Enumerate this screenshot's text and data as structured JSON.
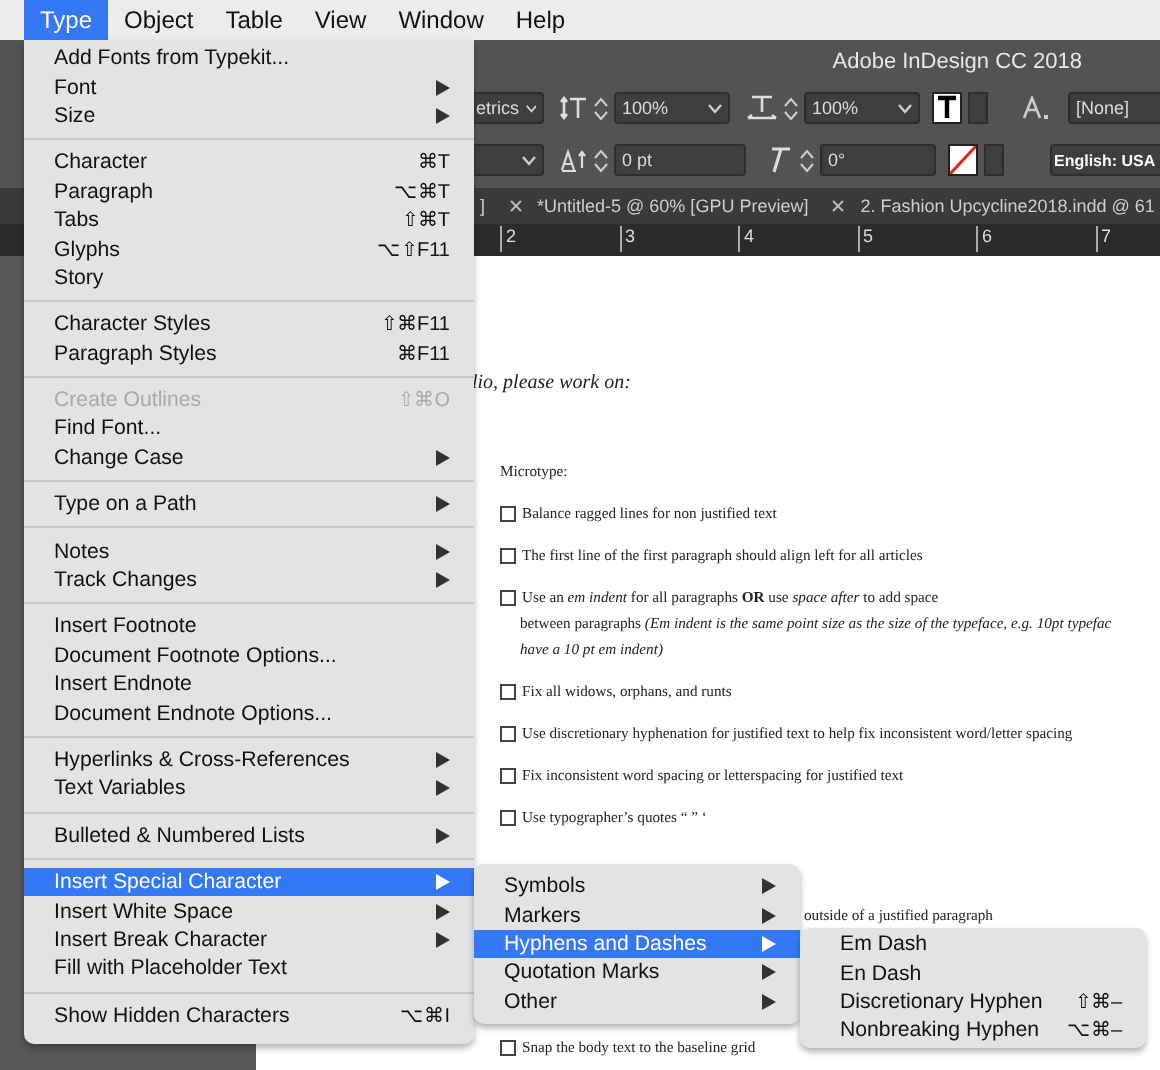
{
  "menu_bar": {
    "items": [
      {
        "label": "Type",
        "selected": true
      },
      {
        "label": "Object",
        "selected": false
      },
      {
        "label": "Table",
        "selected": false
      },
      {
        "label": "View",
        "selected": false
      },
      {
        "label": "Window",
        "selected": false
      },
      {
        "label": "Help",
        "selected": false
      }
    ]
  },
  "window": {
    "title": "Adobe InDesign CC 2018"
  },
  "control_panel": {
    "kerning": "etrics",
    "vertical_scale": "100%",
    "horizontal_scale": "100%",
    "baseline_shift": "0 pt",
    "skew": "0°",
    "character_style": "[None]",
    "language": "English: USA"
  },
  "document_tabs": [
    {
      "label": "]",
      "close_visible": false
    },
    {
      "label": "*Untitled-5 @ 60% [GPU Preview]",
      "close_visible": true
    },
    {
      "label": "2. Fashion Upcycline2018.indd @ 61",
      "close_visible": true
    }
  ],
  "ruler": {
    "marks": [
      "2",
      "3",
      "4",
      "5",
      "6",
      "7"
    ]
  },
  "page": {
    "heading": "lio, please work on:",
    "items": [
      {
        "kind": "label",
        "lines": [
          "Microtype:"
        ]
      },
      {
        "kind": "checkbox",
        "checked": false,
        "lines": [
          "Balance ragged lines for non justified text"
        ]
      },
      {
        "kind": "checkbox",
        "checked": false,
        "lines": [
          "The first line of the first paragraph should align left for all articles"
        ]
      },
      {
        "kind": "checkbox",
        "checked": false,
        "lines": [
          "Use an *em indent* for all paragraphs **OR** use *space after* to add space",
          "between paragraphs *(Em indent is the same point size as the size of the typeface, e.g. 10pt typefac*",
          "*have a 10 pt em indent)*"
        ]
      },
      {
        "kind": "checkbox",
        "checked": false,
        "lines": [
          "Fix all widows, orphans, and runts"
        ]
      },
      {
        "kind": "checkbox",
        "checked": false,
        "lines": [
          "Use discretionary hyphenation for justified text to help fix inconsistent word/letter spacing"
        ]
      },
      {
        "kind": "checkbox",
        "checked": false,
        "lines": [
          "Fix inconsistent word spacing or letterspacing for justified text"
        ]
      },
      {
        "kind": "checkbox",
        "checked": false,
        "lines": [
          "Use typographer’s quotes “ ” ‘"
        ]
      },
      {
        "kind": "fragment",
        "lines": [
          "outside of a justified paragraph"
        ]
      },
      {
        "kind": "checkbox",
        "checked": false,
        "lines": [
          "Snap the body text to the baseline grid"
        ]
      }
    ]
  },
  "type_menu": {
    "groups": [
      [
        {
          "label": "Add Fonts from Typekit...",
          "submenu": false,
          "disabled": false,
          "selected": false
        },
        {
          "label": "Font",
          "submenu": true,
          "disabled": false,
          "selected": false
        },
        {
          "label": "Size",
          "submenu": true,
          "disabled": false,
          "selected": false
        }
      ],
      [
        {
          "label": "Character",
          "shortcut": "⌘T",
          "submenu": false,
          "disabled": false,
          "selected": false
        },
        {
          "label": "Paragraph",
          "shortcut": "⌥⌘T",
          "submenu": false,
          "disabled": false,
          "selected": false
        },
        {
          "label": "Tabs",
          "shortcut": "⇧⌘T",
          "submenu": false,
          "disabled": false,
          "selected": false
        },
        {
          "label": "Glyphs",
          "shortcut": "⌥⇧F11",
          "submenu": false,
          "disabled": false,
          "selected": false
        },
        {
          "label": "Story",
          "submenu": false,
          "disabled": false,
          "selected": false
        }
      ],
      [
        {
          "label": "Character Styles",
          "shortcut": "⇧⌘F11",
          "submenu": false,
          "disabled": false,
          "selected": false
        },
        {
          "label": "Paragraph Styles",
          "shortcut": "⌘F11",
          "submenu": false,
          "disabled": false,
          "selected": false
        }
      ],
      [
        {
          "label": "Create Outlines",
          "shortcut": "⇧⌘O",
          "submenu": false,
          "disabled": true,
          "selected": false
        },
        {
          "label": "Find Font...",
          "submenu": false,
          "disabled": false,
          "selected": false
        },
        {
          "label": "Change Case",
          "submenu": true,
          "disabled": false,
          "selected": false
        }
      ],
      [
        {
          "label": "Type on a Path",
          "submenu": true,
          "disabled": false,
          "selected": false
        }
      ],
      [
        {
          "label": "Notes",
          "submenu": true,
          "disabled": false,
          "selected": false
        },
        {
          "label": "Track Changes",
          "submenu": true,
          "disabled": false,
          "selected": false
        }
      ],
      [
        {
          "label": "Insert Footnote",
          "submenu": false,
          "disabled": false,
          "selected": false
        },
        {
          "label": "Document Footnote Options...",
          "submenu": false,
          "disabled": false,
          "selected": false
        },
        {
          "label": "Insert Endnote",
          "submenu": false,
          "disabled": false,
          "selected": false
        },
        {
          "label": "Document Endnote Options...",
          "submenu": false,
          "disabled": false,
          "selected": false
        }
      ],
      [
        {
          "label": "Hyperlinks & Cross-References",
          "submenu": true,
          "disabled": false,
          "selected": false
        },
        {
          "label": "Text Variables",
          "submenu": true,
          "disabled": false,
          "selected": false
        }
      ],
      [
        {
          "label": "Bulleted & Numbered Lists",
          "submenu": true,
          "disabled": false,
          "selected": false
        }
      ],
      [
        {
          "label": "Insert Special Character",
          "submenu": true,
          "disabled": false,
          "selected": true
        },
        {
          "label": "Insert White Space",
          "submenu": true,
          "disabled": false,
          "selected": false
        },
        {
          "label": "Insert Break Character",
          "submenu": true,
          "disabled": false,
          "selected": false
        },
        {
          "label": "Fill with Placeholder Text",
          "submenu": false,
          "disabled": false,
          "selected": false
        }
      ],
      [
        {
          "label": "Show Hidden Characters",
          "shortcut": "⌥⌘I",
          "submenu": false,
          "disabled": false,
          "selected": false
        }
      ]
    ]
  },
  "special_character_menu": {
    "items": [
      {
        "label": "Symbols",
        "submenu": true,
        "selected": false
      },
      {
        "label": "Markers",
        "submenu": true,
        "selected": false
      },
      {
        "label": "Hyphens and Dashes",
        "submenu": true,
        "selected": true
      },
      {
        "label": "Quotation Marks",
        "submenu": true,
        "selected": false
      },
      {
        "label": "Other",
        "submenu": true,
        "selected": false
      }
    ]
  },
  "hyphens_menu": {
    "items": [
      {
        "label": "Em Dash",
        "submenu": false,
        "selected": false
      },
      {
        "label": "En Dash",
        "submenu": false,
        "selected": false
      },
      {
        "label": "Discretionary Hyphen",
        "shortcut": "⇧⌘–",
        "submenu": false,
        "selected": false
      },
      {
        "label": "Nonbreaking Hyphen",
        "shortcut": "⌥⌘–",
        "submenu": false,
        "selected": false
      }
    ]
  }
}
